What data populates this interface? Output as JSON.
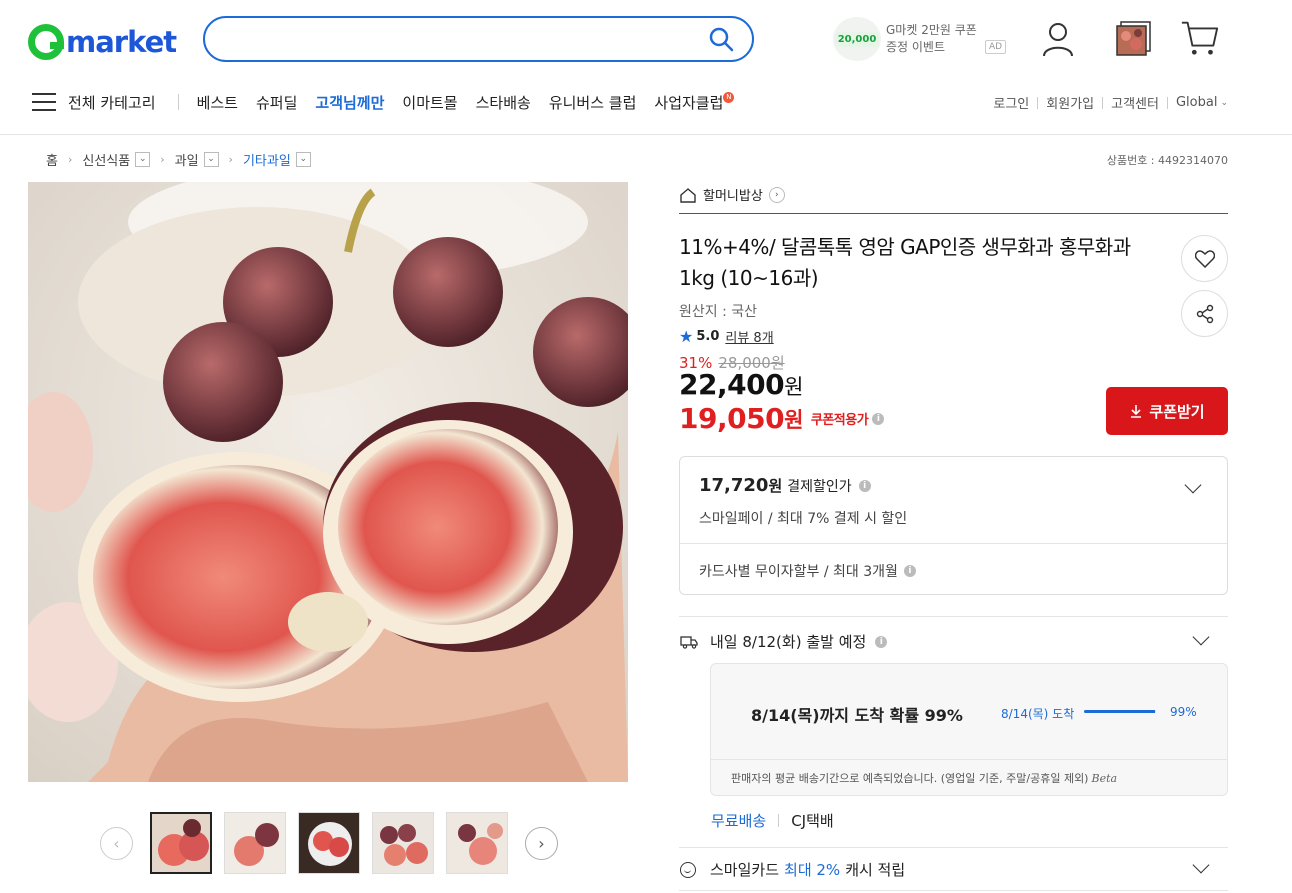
{
  "logo": {
    "text": "market"
  },
  "search": {
    "placeholder": ""
  },
  "ad": {
    "coupon_badge": "20,000",
    "line1": "G마켓 2만원 쿠폰",
    "line2": "증정 이벤트",
    "badge": "AD"
  },
  "nav": {
    "all_categories": "전체 카테고리",
    "items": [
      {
        "label": "베스트"
      },
      {
        "label": "슈퍼딜"
      },
      {
        "label": "고객님께만"
      },
      {
        "label": "이마트몰"
      },
      {
        "label": "스타배송"
      },
      {
        "label": "유니버스 클럽"
      },
      {
        "label": "사업자클럽"
      }
    ],
    "new_badge": "N",
    "util": [
      "로그인",
      "회원가입",
      "고객센터",
      "Global"
    ]
  },
  "breadcrumb": {
    "home": "홈",
    "levels": [
      "신선식품",
      "과일",
      "기타과일"
    ]
  },
  "product_no": "상품번호 : 4492314070",
  "shop_name": "할머니밥상",
  "product": {
    "title": "11%+4%/ 달콤톡톡 영암 GAP인증 생무화과 홍무화과 1kg (10~16과)",
    "origin": "원산지 : 국산",
    "rating": "5.0",
    "reviews": "리뷰 8개",
    "discount_pct": "31%",
    "original_price": "28,000원",
    "price_num": "22,400",
    "price_unit": "원",
    "coupon_price_num": "19,050",
    "coupon_price_unit": "원",
    "coupon_label": "쿠폰적용가",
    "coupon_button": "쿠폰받기"
  },
  "payment": {
    "price_num": "17,720",
    "price_unit": "원",
    "label": "결제할인가",
    "sub": "스마일페이 / 최대 7% 결제 시 할인",
    "card": "카드사별 무이자할부 / 최대 3개월"
  },
  "shipping": {
    "title": "내일 8/12(화) 출발 예정",
    "arrival_main": "8/14(목)까지 도착 확률 99%",
    "arrival_label": "8/14(목) 도착",
    "arrival_pct_text": "99%",
    "arrival_probability": 0.99,
    "note": "판매자의 평균 배송기간으로 예측되었습니다. (영업일 기준, 주말/공휴일 제외)",
    "beta": "Beta",
    "free": "무료배송",
    "carrier": "CJ택배"
  },
  "smilecard": {
    "prefix": "스마일카드",
    "highlight": "최대 2%",
    "suffix": "캐시 적립"
  },
  "colors": {
    "accent": "#1c6bd6",
    "brand_green": "#1fc03a",
    "sale_red": "#e02020",
    "button_red": "#d9161a"
  }
}
